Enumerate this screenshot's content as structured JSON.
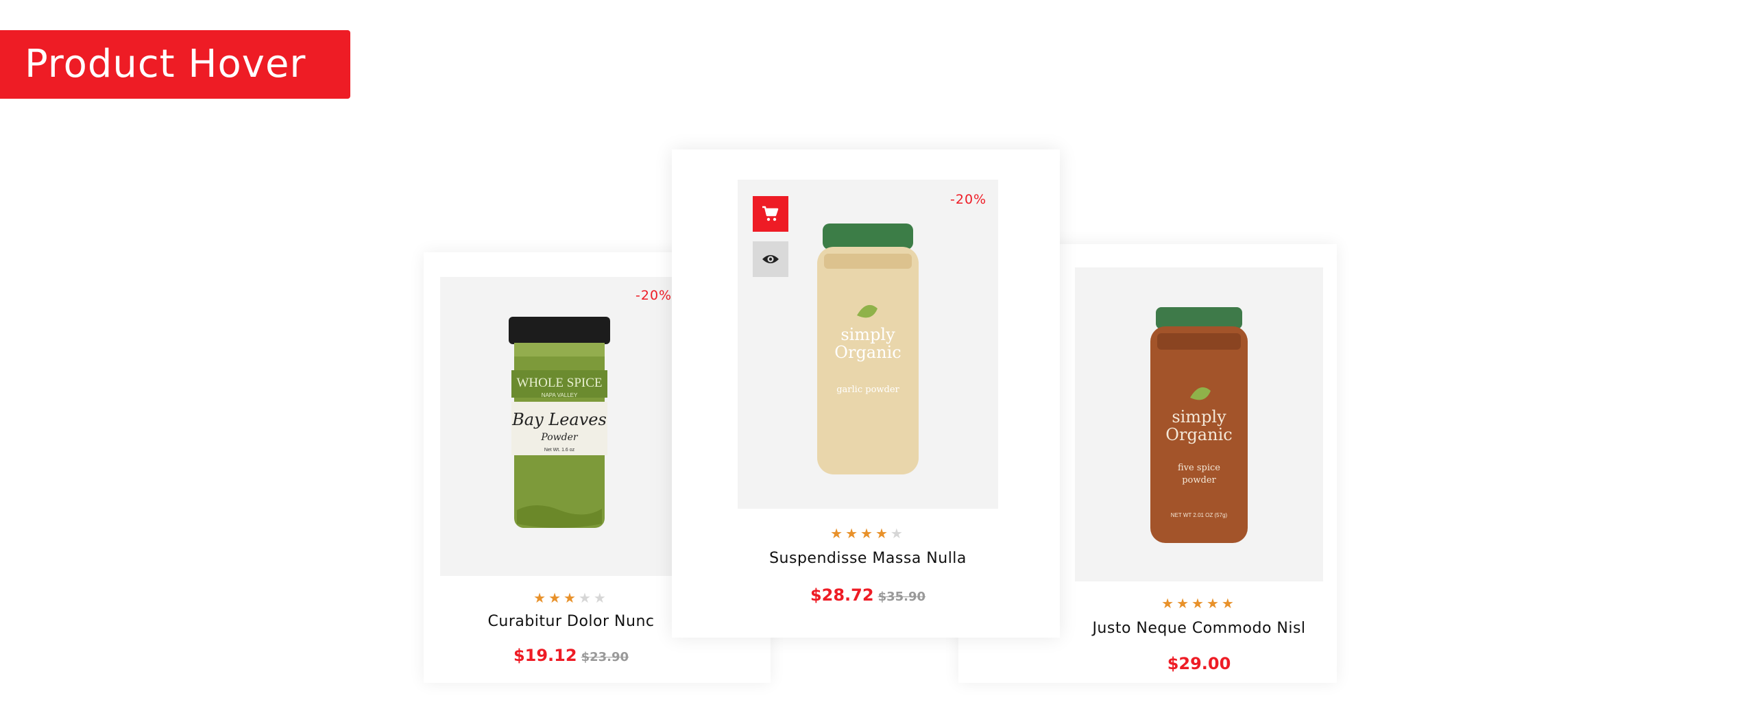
{
  "page": {
    "title": "Product Hover"
  },
  "products": [
    {
      "name": "Curabitur Dolor Nunc",
      "discount": "-20%",
      "price": "$19.12",
      "old_price": "$23.90",
      "rating": 3
    },
    {
      "name": "Suspendisse Massa Nulla",
      "discount": "-20%",
      "price": "$28.72",
      "old_price": "$35.90",
      "rating": 4,
      "jar_label": {
        "brand_line1": "simply",
        "brand_line2": "Organic",
        "product": "garlic powder"
      }
    },
    {
      "name": "Justo Neque Commodo Nisl",
      "discount": "",
      "price": "$29.00",
      "old_price": "",
      "rating": 5,
      "jar_label": {
        "brand_line1": "simply",
        "brand_line2": "Organic",
        "product_line1": "five spice",
        "product_line2": "powder",
        "net": "NET WT 2.01 OZ (57g)"
      }
    }
  ],
  "jar1_label": {
    "brand": "WHOLE SPICE",
    "sub": "NAPA VALLEY",
    "name_line1": "Bay Leaves",
    "name_line2": "Powder",
    "net": "Net Wt. 1.6 oz"
  },
  "icons": {
    "cart": "cart-icon",
    "view": "eye-icon",
    "star": "star-icon"
  },
  "colors": {
    "accent": "#ee1c25",
    "star": "#e8912a",
    "star_off": "#d6d6d6"
  }
}
